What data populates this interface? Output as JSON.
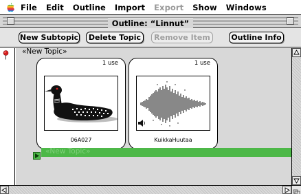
{
  "menubar": {
    "apple_icon": "apple-logo-icon",
    "items": [
      {
        "label": "File",
        "enabled": true
      },
      {
        "label": "Edit",
        "enabled": true
      },
      {
        "label": "Outline",
        "enabled": true
      },
      {
        "label": "Import",
        "enabled": true
      },
      {
        "label": "Export",
        "enabled": false
      },
      {
        "label": "Show",
        "enabled": true
      },
      {
        "label": "Windows",
        "enabled": true
      }
    ]
  },
  "window": {
    "title": "Outline: “Linnut”"
  },
  "toolbar": {
    "new_subtopic": "New Subtopic",
    "delete_topic": "Delete Topic",
    "remove_item": "Remove Item",
    "outline_info": "Outline Info"
  },
  "outline": {
    "topic_label": "«New Topic»",
    "cards": [
      {
        "uses": "1 use",
        "caption": "06A027",
        "kind": "image",
        "icon": "loon-bird-image"
      },
      {
        "uses": "1 use",
        "caption": "KuikkaHuutaa",
        "kind": "sound",
        "icon": "sound-waveform-image"
      }
    ],
    "subtopic_label": "«New Topic»"
  },
  "colors": {
    "subtopic_bar": "#4db848",
    "menu_disabled": "#9a9a9a",
    "pin": "#d62020"
  }
}
